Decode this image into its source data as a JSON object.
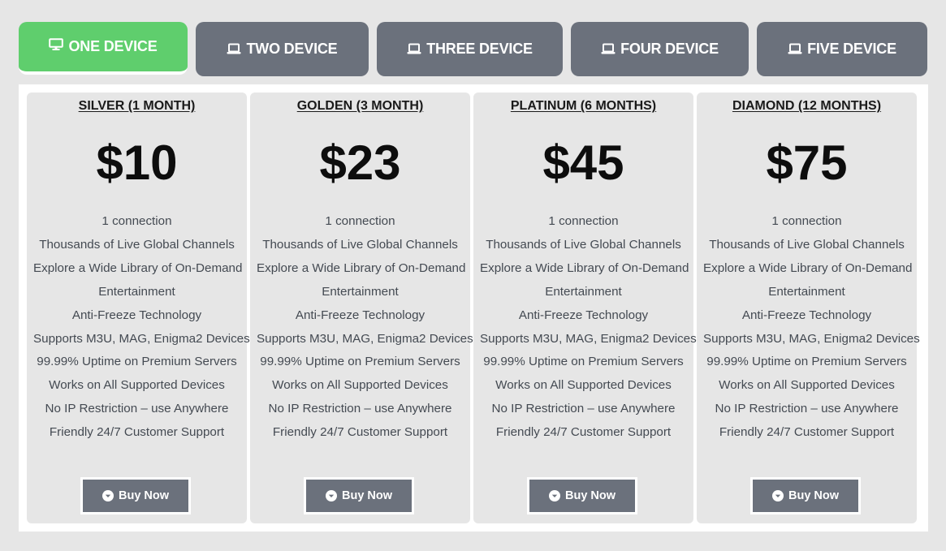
{
  "tabs": [
    {
      "label": "ONE DEVICE",
      "icon": "monitor-icon",
      "active": true
    },
    {
      "label": "TWO DEVICE",
      "icon": "laptop-icon",
      "active": false
    },
    {
      "label": "THREE DEVICE",
      "icon": "laptop-icon",
      "active": false
    },
    {
      "label": "FOUR DEVICE",
      "icon": "laptop-icon",
      "active": false
    },
    {
      "label": "FIVE DEVICE",
      "icon": "laptop-icon",
      "active": false
    }
  ],
  "colors": {
    "active_tab": "#5fce6d",
    "inactive_tab": "#6b717c",
    "button": "#6b717c",
    "card_bg": "#e6e6e6"
  },
  "plans": [
    {
      "title": "SILVER (1 MONTH)",
      "price": "$10",
      "features": [
        "1 connection",
        "Thousands of Live Global Channels",
        "Explore a Wide Library of On-Demand",
        "Entertainment",
        "Anti-Freeze Technology",
        "Supports M3U, MAG, Enigma2 Devices",
        "99.99% Uptime on Premium Servers",
        "Works on All Supported Devices",
        "No IP Restriction – use Anywhere",
        "Friendly 24/7 Customer Support"
      ],
      "button_label": "Buy Now",
      "button_icon": "chevron-down-circle-icon"
    },
    {
      "title": "GOLDEN (3 MONTH)",
      "price": "$23",
      "features": [
        "1 connection",
        "Thousands of Live Global Channels",
        "Explore a Wide Library of On-Demand",
        "Entertainment",
        "Anti-Freeze Technology",
        "Supports M3U, MAG, Enigma2 Devices",
        "99.99% Uptime on Premium Servers",
        "Works on All Supported Devices",
        "No IP Restriction – use Anywhere",
        "Friendly 24/7 Customer Support"
      ],
      "button_label": "Buy Now",
      "button_icon": "chevron-down-circle-icon"
    },
    {
      "title": "PLATINUM (6 MONTHS)",
      "price": "$45",
      "features": [
        "1 connection",
        "Thousands of Live Global Channels",
        "Explore a Wide Library of On-Demand",
        "Entertainment",
        "Anti-Freeze Technology",
        "Supports M3U, MAG, Enigma2 Devices",
        "99.99% Uptime on Premium Servers",
        "Works on All Supported Devices",
        "No IP Restriction – use Anywhere",
        "Friendly 24/7 Customer Support"
      ],
      "button_label": "Buy Now",
      "button_icon": "chevron-down-circle-icon"
    },
    {
      "title": "DIAMOND (12 MONTHS)",
      "price": "$75",
      "features": [
        "1 connection",
        "Thousands of Live Global Channels",
        "Explore a Wide Library of On-Demand",
        "Entertainment",
        "Anti-Freeze Technology",
        "Supports M3U, MAG, Enigma2 Devices",
        "99.99% Uptime on Premium Servers",
        "Works on All Supported Devices",
        "No IP Restriction – use Anywhere",
        "Friendly 24/7 Customer Support"
      ],
      "button_label": "Buy Now",
      "button_icon": "chevron-down-circle-icon"
    }
  ]
}
